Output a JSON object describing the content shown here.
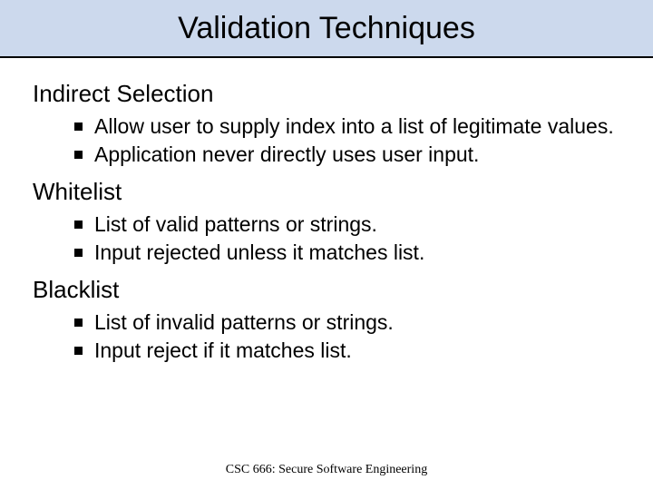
{
  "title": "Validation Techniques",
  "sections": [
    {
      "heading": "Indirect Selection",
      "bullets": [
        "Allow user to supply index into a list of legitimate values.",
        "Application never directly uses user input."
      ]
    },
    {
      "heading": "Whitelist",
      "bullets": [
        "List of valid patterns or strings.",
        "Input rejected unless it matches list."
      ]
    },
    {
      "heading": "Blacklist",
      "bullets": [
        "List of invalid patterns or strings.",
        "Input reject if it matches list."
      ]
    }
  ],
  "footer": "CSC 666: Secure Software Engineering"
}
